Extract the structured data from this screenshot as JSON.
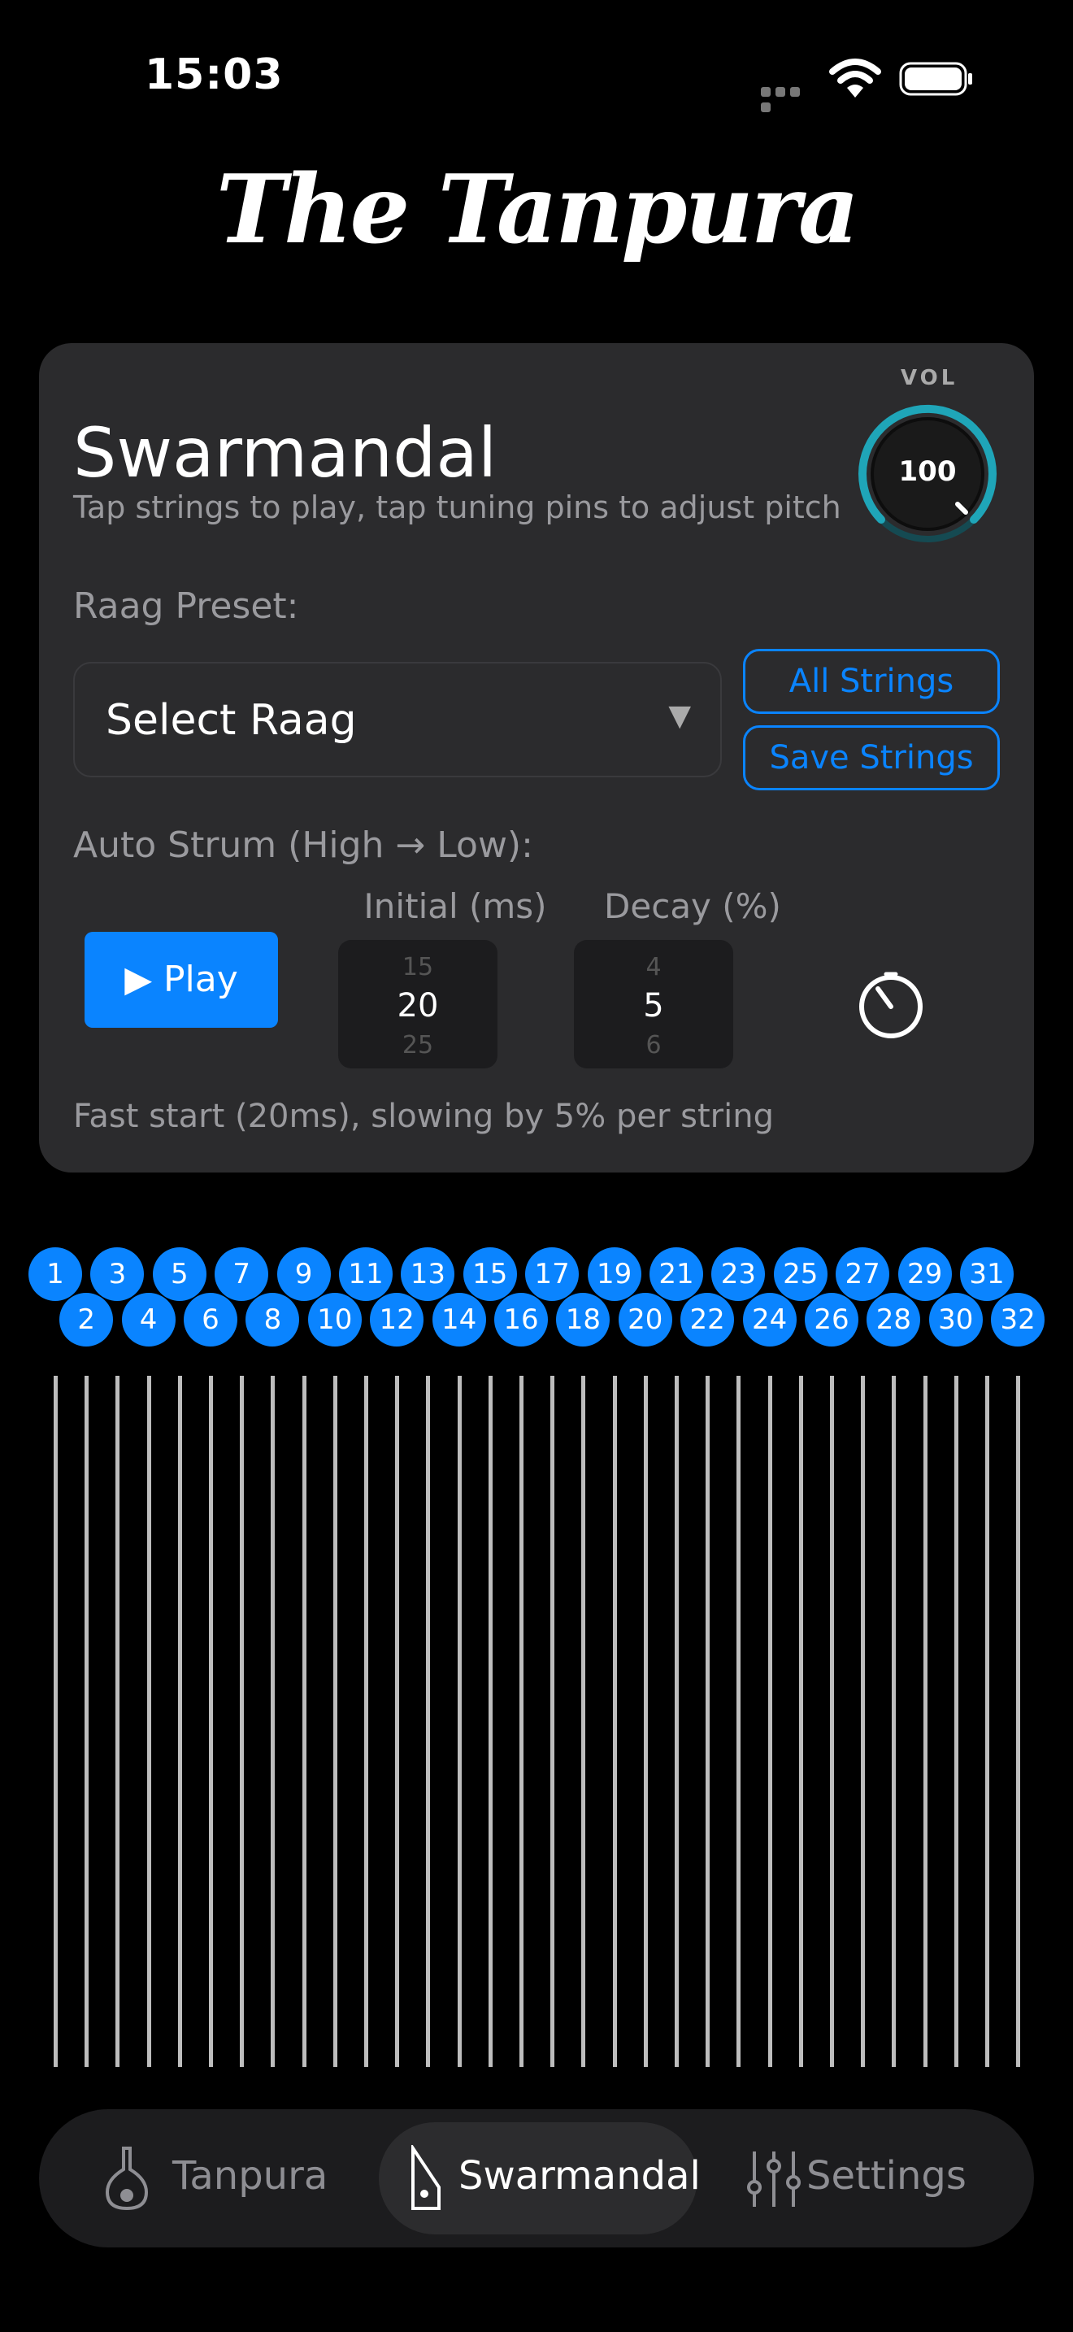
{
  "status": {
    "time": "15:03"
  },
  "logo": "The Tanpura",
  "card": {
    "title": "Swarmandal",
    "subtitle": "Tap strings to play, tap tuning pins to adjust pitch",
    "volume": {
      "label": "VOL",
      "value": "100",
      "level_percent": 100
    },
    "raag": {
      "label": "Raag Preset:",
      "select_value": "Select Raag"
    },
    "buttons": {
      "all_strings": "All Strings",
      "save_strings": "Save Strings"
    },
    "strum": {
      "label": "Auto Strum (High → Low):",
      "play": "▶ Play",
      "initial": {
        "title": "Initial (ms)",
        "prev": "15",
        "value": "20",
        "next": "25"
      },
      "decay": {
        "title": "Decay (%)",
        "prev": "4",
        "value": "5",
        "next": "6"
      },
      "description": "Fast start (20ms), slowing by 5% per string"
    }
  },
  "pins": [
    "1",
    "2",
    "3",
    "4",
    "5",
    "6",
    "7",
    "8",
    "9",
    "10",
    "11",
    "12",
    "13",
    "14",
    "15",
    "16",
    "17",
    "18",
    "19",
    "20",
    "21",
    "22",
    "23",
    "24",
    "25",
    "26",
    "27",
    "28",
    "29",
    "30",
    "31",
    "32"
  ],
  "tabs": [
    {
      "label": "Tanpura",
      "icon": "tanpura-icon",
      "active": false
    },
    {
      "label": "Swarmandal",
      "icon": "swarmandal-icon",
      "active": true
    },
    {
      "label": "Settings",
      "icon": "sliders-icon",
      "active": false
    }
  ],
  "colors": {
    "accent": "#0a84ff",
    "card": "#2b2b2d",
    "knob_ring": "#1fa5b8"
  }
}
